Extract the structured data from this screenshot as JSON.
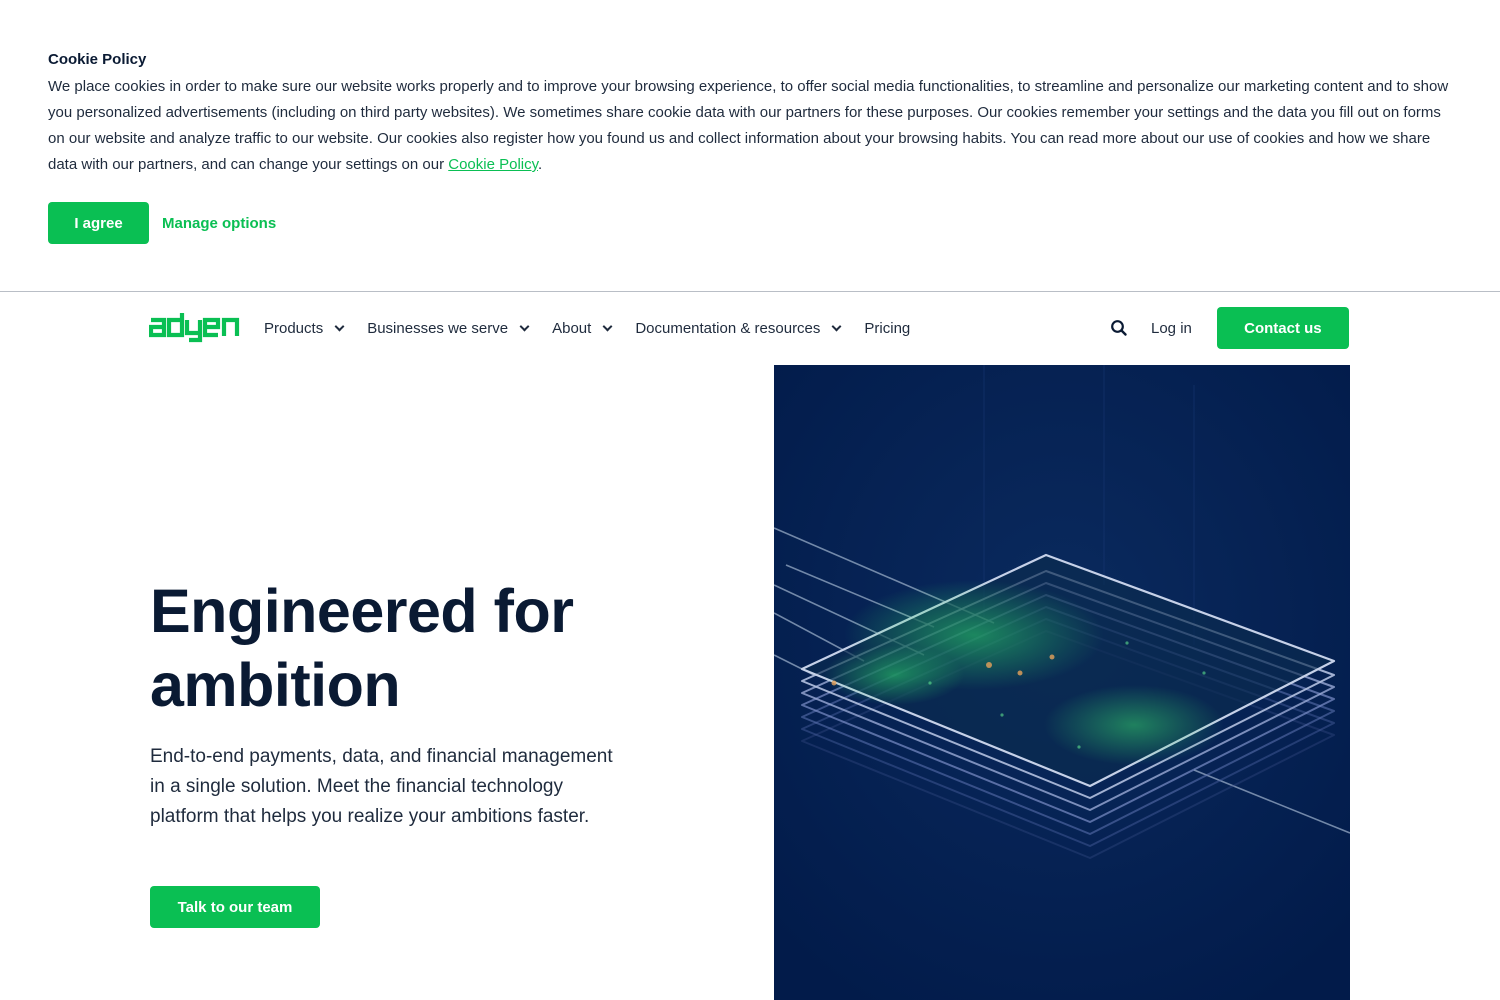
{
  "cookie": {
    "title": "Cookie Policy",
    "text": "We place cookies in order to make sure our website works properly and to improve your browsing experience, to offer social media functionalities, to streamline and personalize our marketing content and to show you personalized advertisements (including on third party websites). We sometimes share cookie data with our partners for these purposes. Our cookies remember your settings and the data you fill out on forms on our website and analyze traffic to our website. Our cookies also register how you found us and collect information about your browsing habits. You can read more about our use of cookies and how we share data with our partners, and can change your settings on our ",
    "link": "Cookie Policy",
    "text_end": ".",
    "agree_label": "I agree",
    "manage_label": "Manage options"
  },
  "nav": {
    "logo": "adyen",
    "items": [
      {
        "label": "Products",
        "dropdown": true
      },
      {
        "label": "Businesses we serve",
        "dropdown": true
      },
      {
        "label": "About",
        "dropdown": true
      },
      {
        "label": "Documentation & resources",
        "dropdown": true
      },
      {
        "label": "Pricing",
        "dropdown": false
      }
    ],
    "search_icon": "search-icon",
    "login_label": "Log in",
    "contact_label": "Contact us"
  },
  "hero": {
    "title": "Engineered for ambition",
    "subtitle": "End-to-end payments, data, and financial management in a single solution. Meet the financial technology platform that helps you realize your ambitions faster.",
    "cta_label": "Talk to our team"
  },
  "colors": {
    "brand_green": "#0abf53",
    "text_dark": "#0a1a33",
    "hero_bg": "#021b4a"
  }
}
